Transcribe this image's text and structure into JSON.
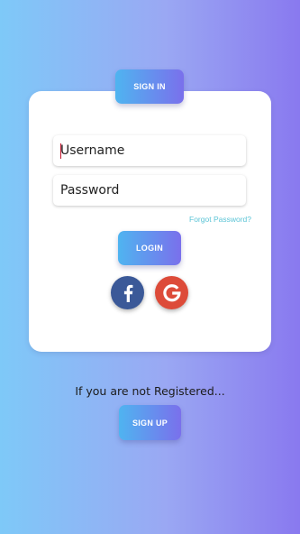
{
  "colors": {
    "background_start": "#7ec9f8",
    "background_end": "#8979ef",
    "button_start": "#4fb4f0",
    "button_end": "#7a70ec",
    "facebook": "#3b5998",
    "google": "#dd4b39",
    "link": "#5bc4d6"
  },
  "header": {
    "signin_label": "SIGN IN"
  },
  "form": {
    "username_placeholder": "Username",
    "password_placeholder": "Password",
    "forgot_label": "Forgot Password?",
    "login_label": "LOGIN"
  },
  "social": {
    "facebook_icon": "facebook-icon",
    "google_icon": "google-icon"
  },
  "footer": {
    "prompt": "If you are not Registered...",
    "signup_label": "SIGN UP"
  }
}
